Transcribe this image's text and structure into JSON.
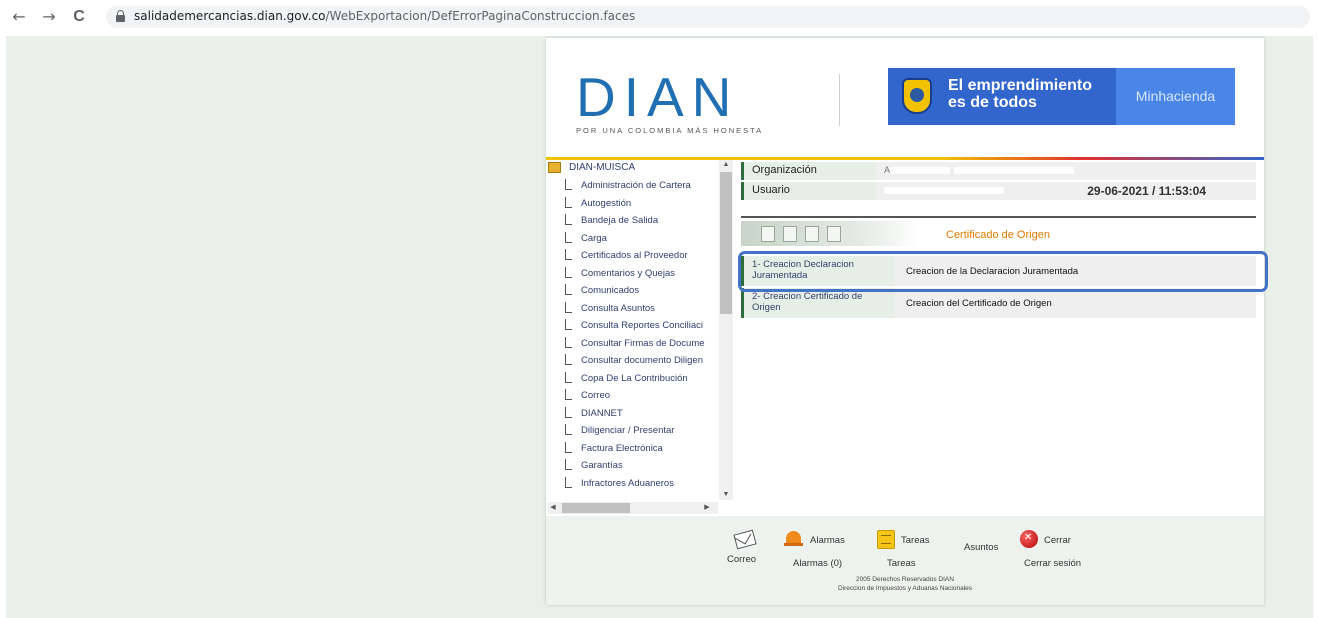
{
  "browser": {
    "back": "←",
    "forward": "→",
    "reload": "C",
    "url_host": "salidademercancias.dian.gov.co",
    "url_path": "/WebExportacion/DefErrorPaginaConstruccion.faces"
  },
  "header": {
    "logo_word": "DIAN",
    "logo_tagline": "POR UNA COLOMBIA MÁS HONESTA",
    "brand_line1": "El emprendimiento",
    "brand_line2": "es de todos",
    "ministry": "Minhacienda"
  },
  "sidebar": {
    "root": "DIAN-MUISCA",
    "items": [
      {
        "label": "Administración de Cartera"
      },
      {
        "label": "Autogestión"
      },
      {
        "label": "Bandeja de Salida"
      },
      {
        "label": "Carga"
      },
      {
        "label": "Certificados al Proveedor"
      },
      {
        "label": "Comentarios y Quejas"
      },
      {
        "label": "Comunicados"
      },
      {
        "label": "Consulta Asuntos"
      },
      {
        "label": "Consulta Reportes Conciliaci"
      },
      {
        "label": "Consultar Firmas de Docume"
      },
      {
        "label": "Consultar documento Diligen"
      },
      {
        "label": "Copa De La Contribución"
      },
      {
        "label": "Correo"
      },
      {
        "label": "DIANNET"
      },
      {
        "label": "Diligenciar / Presentar"
      },
      {
        "label": "Factura Electrónica"
      },
      {
        "label": "Garantías"
      },
      {
        "label": "Infractores Aduaneros"
      }
    ]
  },
  "info": {
    "org_label": "Organización",
    "org_value": "A",
    "user_label": "Usuario",
    "datetime": "29-06-2021 / 11:53:04"
  },
  "section": {
    "title": "Certificado de Origen",
    "options": [
      {
        "code": "1- Creacion Declaracion Juramentada",
        "desc": "Creacion de la Declaracion Juramentada"
      },
      {
        "code": "2- Creacion Certificado de Origen",
        "desc": "Creacion del Certificado de Origen"
      }
    ]
  },
  "footer": {
    "mail_label": "Correo",
    "alarms_title": "Alarmas",
    "alarms_link": "Alarmas (0)",
    "tasks_title": "Tareas",
    "tasks_link": "Tareas",
    "matters": "Asuntos",
    "close_title": "Cerrar",
    "close_link": "Cerrar sesión",
    "copyright1": "2005 Derechos Reservados DIAN",
    "copyright2": "Direccion de Impuestos y Aduanas Nacionales"
  },
  "colors": {
    "highlight": "#4472c4",
    "accent_orange": "#e07b00",
    "dian_blue": "#1f6fb2"
  }
}
